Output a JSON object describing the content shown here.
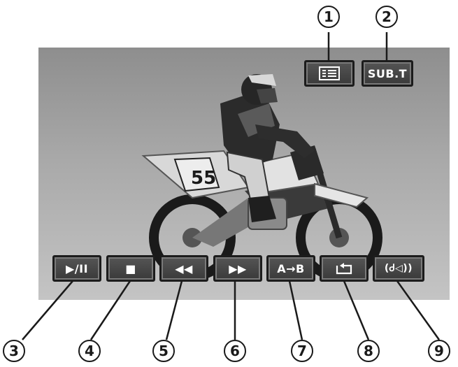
{
  "top_controls": [
    {
      "id": "menu",
      "icon": "list-icon",
      "label": ""
    },
    {
      "id": "subtitle",
      "icon": "",
      "label": "SUB.T"
    }
  ],
  "bottom_controls": [
    {
      "id": "play-pause",
      "icon": "play-pause-icon",
      "label": "▶/II"
    },
    {
      "id": "stop",
      "icon": "stop-icon",
      "label": "■"
    },
    {
      "id": "rewind",
      "icon": "rewind-icon",
      "label": "◀◀"
    },
    {
      "id": "fast-forward",
      "icon": "fast-forward-icon",
      "label": "▶▶"
    },
    {
      "id": "ab-repeat",
      "icon": "",
      "label": "A→B"
    },
    {
      "id": "repeat",
      "icon": "repeat-icon",
      "label": ""
    },
    {
      "id": "audio",
      "icon": "audio-icon",
      "label": "(Ꮷ◁))"
    }
  ],
  "callouts": [
    "1",
    "2",
    "3",
    "4",
    "5",
    "6",
    "7",
    "8",
    "9"
  ],
  "colors": {
    "button_bg": "#464646",
    "button_border": "#1c1c1c",
    "screen_top": "#8e8e8e",
    "screen_bottom": "#c4c4c4"
  }
}
